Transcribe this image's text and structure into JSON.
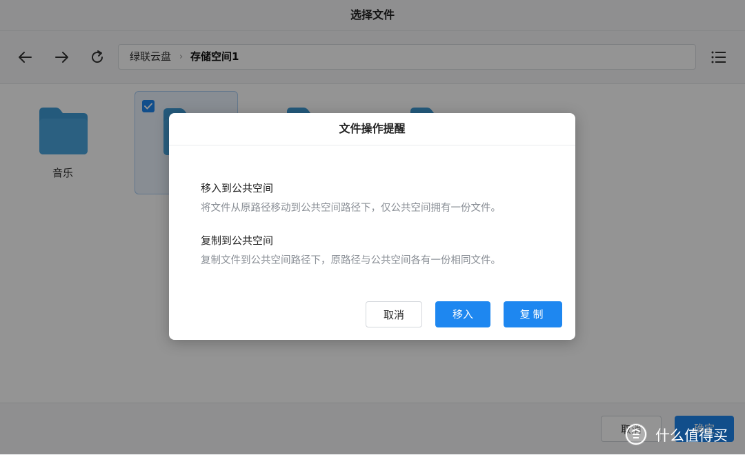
{
  "window": {
    "title": "选择文件"
  },
  "breadcrumb": {
    "items": [
      "绿联云盘",
      "存储空间1"
    ],
    "separator": "›"
  },
  "folders": [
    {
      "label": "音乐",
      "selected": false
    },
    {
      "label": "",
      "selected": true
    },
    {
      "label": "",
      "selected": false
    },
    {
      "label": "",
      "selected": false
    }
  ],
  "footer": {
    "cancel_label": "取消",
    "ok_label": "确定"
  },
  "dialog": {
    "title": "文件操作提醒",
    "options": [
      {
        "title": "移入到公共空间",
        "desc": "将文件从原路径移动到公共空间路径下，仅公共空间拥有一份文件。"
      },
      {
        "title": "复制到公共空间",
        "desc": "复制文件到公共空间路径下，原路径与公共空间各有一份相同文件。"
      }
    ],
    "buttons": {
      "cancel": "取消",
      "move": "移入",
      "copy": "复制"
    }
  },
  "watermark": {
    "text": "什么值得买"
  },
  "icons": {
    "back": "arrow-left-icon",
    "forward": "arrow-right-icon",
    "refresh": "refresh-icon",
    "list": "list-view-icon",
    "folder": "folder-icon",
    "check": "checkmark-icon"
  },
  "colors": {
    "accent": "#1e87f0",
    "folder": "#4aa6df"
  }
}
